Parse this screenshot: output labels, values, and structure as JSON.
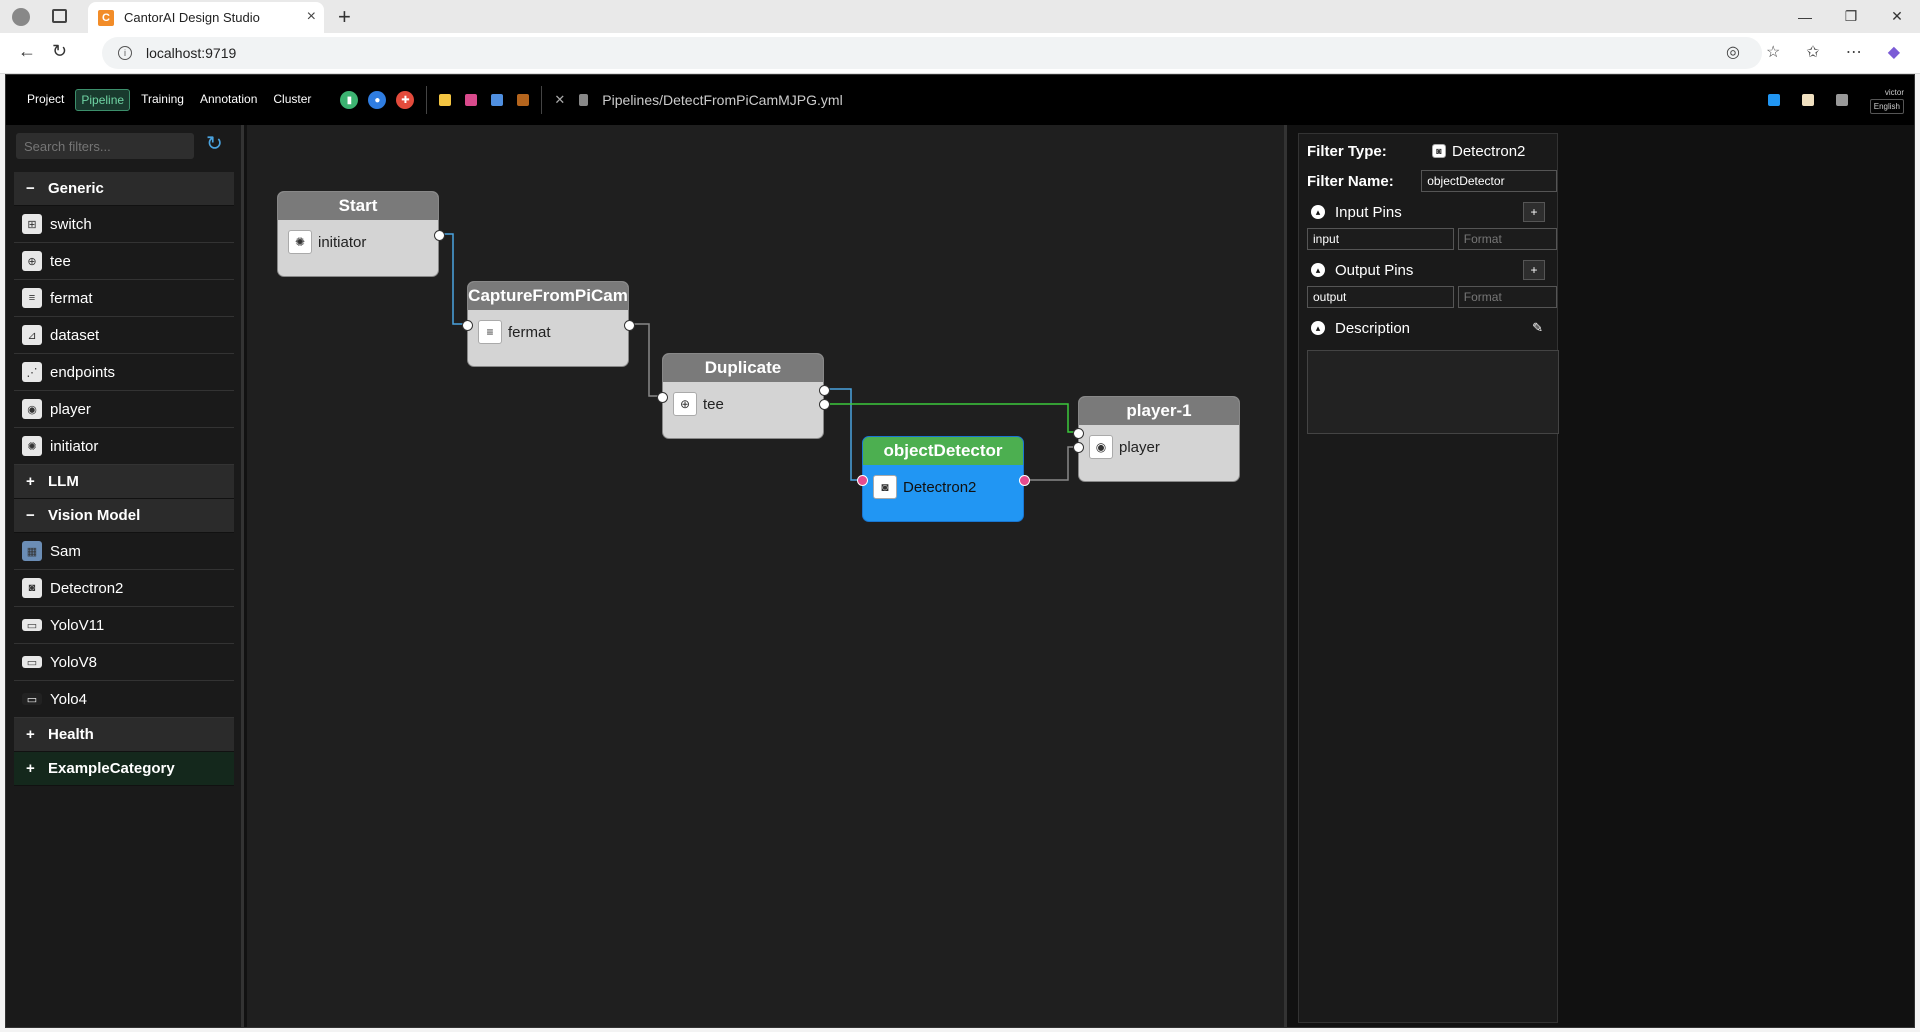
{
  "browser": {
    "tab_title": "CantorAI Design Studio",
    "url": "localhost:9719"
  },
  "topbar": {
    "menu": [
      "Project",
      "Pipeline",
      "Training",
      "Annotation",
      "Cluster"
    ],
    "active_menu": "Pipeline",
    "file_path": "Pipelines/DetectFromPiCamMJPG.yml",
    "user": "victor",
    "language": "English"
  },
  "sidebar": {
    "search_placeholder": "Search filters...",
    "categories": [
      {
        "label": "Generic",
        "sign": "−",
        "items": [
          "switch",
          "tee",
          "fermat",
          "dataset",
          "endpoints",
          "player",
          "initiator"
        ]
      },
      {
        "label": "LLM",
        "sign": "+"
      },
      {
        "label": "Vision Model",
        "sign": "−",
        "items": [
          "Sam",
          "Detectron2",
          "YoloV11",
          "YoloV8",
          "Yolo4"
        ]
      },
      {
        "label": "Health",
        "sign": "+"
      },
      {
        "label": "ExampleCategory",
        "sign": "+"
      }
    ]
  },
  "nodes": {
    "start": {
      "title": "Start",
      "filter": "initiator"
    },
    "capture": {
      "title": "CaptureFromPiCam",
      "filter": "fermat"
    },
    "duplicate": {
      "title": "Duplicate",
      "filter": "tee"
    },
    "detector": {
      "title": "objectDetector",
      "filter": "Detectron2"
    },
    "player": {
      "title": "player-1",
      "filter": "player"
    }
  },
  "colors": {
    "selected_node": "#2196f3",
    "selected_header": "#4caf50",
    "wire": "#4aa3df",
    "wire_active": "#3cc83c"
  },
  "properties": {
    "filter_type_label": "Filter Type:",
    "filter_type": "Detectron2",
    "filter_name_label": "Filter Name:",
    "filter_name": "objectDetector",
    "input_pins_label": "Input Pins",
    "input_pin": "input",
    "output_pins_label": "Output Pins",
    "output_pin": "output",
    "format_placeholder": "Format",
    "description_label": "Description"
  }
}
